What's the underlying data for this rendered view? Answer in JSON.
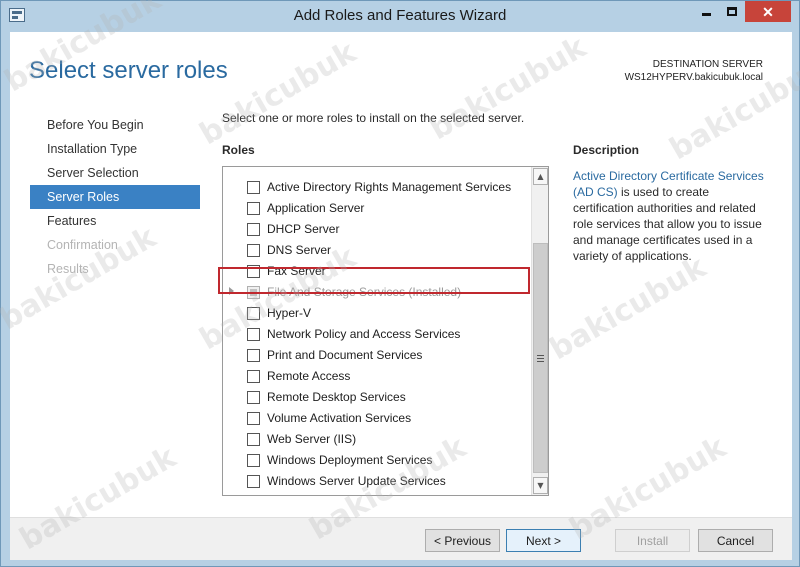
{
  "window": {
    "title": "Add Roles and Features Wizard",
    "close_glyph": "✕"
  },
  "page": {
    "title": "Select server roles",
    "destination_label": "DESTINATION SERVER",
    "destination_server": "WS12HYPERV.bakicubuk.local"
  },
  "nav": {
    "items": [
      {
        "label": "Before You Begin",
        "state": "normal"
      },
      {
        "label": "Installation Type",
        "state": "normal"
      },
      {
        "label": "Server Selection",
        "state": "normal"
      },
      {
        "label": "Server Roles",
        "state": "active"
      },
      {
        "label": "Features",
        "state": "normal"
      },
      {
        "label": "Confirmation",
        "state": "disabled"
      },
      {
        "label": "Results",
        "state": "disabled"
      }
    ]
  },
  "main": {
    "instruction": "Select one or more roles to install on the selected server.",
    "roles_label": "Roles",
    "roles": [
      {
        "label": "Active Directory Rights Management Services",
        "checked": false
      },
      {
        "label": "Application Server",
        "checked": false
      },
      {
        "label": "DHCP Server",
        "checked": false
      },
      {
        "label": "DNS Server",
        "checked": false
      },
      {
        "label": "Fax Server",
        "checked": false
      },
      {
        "label": "File And Storage Services (Installed)",
        "checked": "partial",
        "expandable": true
      },
      {
        "label": "Hyper-V",
        "checked": false,
        "highlighted": true
      },
      {
        "label": "Network Policy and Access Services",
        "checked": false
      },
      {
        "label": "Print and Document Services",
        "checked": false
      },
      {
        "label": "Remote Access",
        "checked": false
      },
      {
        "label": "Remote Desktop Services",
        "checked": false
      },
      {
        "label": "Volume Activation Services",
        "checked": false
      },
      {
        "label": "Web Server (IIS)",
        "checked": false
      },
      {
        "label": "Windows Deployment Services",
        "checked": false
      },
      {
        "label": "Windows Server Update Services",
        "checked": false
      }
    ]
  },
  "description": {
    "title": "Description",
    "link_text": "Active Directory Certificate Services (AD CS)",
    "body": " is used to create certification authorities and related role services that allow you to issue and manage certificates used in a variety of applications."
  },
  "footer": {
    "previous_label": "< Previous",
    "next_label": "Next >",
    "install_label": "Install",
    "cancel_label": "Cancel"
  },
  "watermark": {
    "text": "bakicubuk"
  },
  "colors": {
    "accent": "#3a81c4",
    "title_blue": "#2a6aa0",
    "highlight_red": "#c0282e",
    "frame": "#b6d0e4"
  }
}
